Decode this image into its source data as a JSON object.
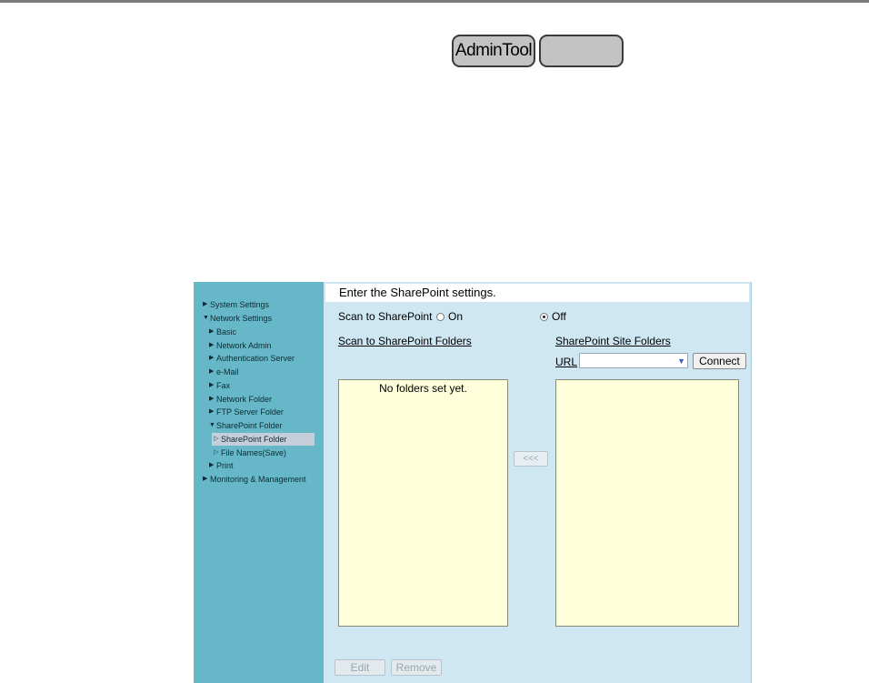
{
  "top_buttons": {
    "admin_tool": "AdminTool",
    "blank": ""
  },
  "sidebar": {
    "items": [
      {
        "label": "System Settings",
        "arrow": "▶"
      },
      {
        "label": "Network Settings",
        "arrow": "▼"
      },
      {
        "label": "Basic",
        "arrow": "▶"
      },
      {
        "label": "Network Admin",
        "arrow": "▶"
      },
      {
        "label": "Authentication Server",
        "arrow": "▶"
      },
      {
        "label": "e-Mail",
        "arrow": "▶"
      },
      {
        "label": "Fax",
        "arrow": "▶"
      },
      {
        "label": "Network Folder",
        "arrow": "▶"
      },
      {
        "label": "FTP Server Folder",
        "arrow": "▶"
      },
      {
        "label": "SharePoint Folder",
        "arrow": "▼"
      },
      {
        "label": "SharePoint Folder",
        "arrow": "▷"
      },
      {
        "label": "File Names(Save)",
        "arrow": "▷"
      },
      {
        "label": "Print",
        "arrow": "▶"
      },
      {
        "label": "Monitoring & Management",
        "arrow": "▶"
      }
    ]
  },
  "main": {
    "header": "Enter the SharePoint settings.",
    "scan_label": "Scan to SharePoint",
    "option_on": "On",
    "option_off": "Off",
    "selected_option": "Off",
    "left_section_title": "Scan to SharePoint Folders",
    "right_section_title": "SharePoint Site Folders",
    "url_label": "URL",
    "url_value": "",
    "connect_button": "Connect",
    "empty_message": "No folders set yet.",
    "move_button": "<<<",
    "edit_button": "Edit",
    "remove_button": "Remove"
  },
  "colors": {
    "sidebar_bg": "#66b8c9",
    "main_bg": "#cfe7f2",
    "folder_box_bg": "#ffffdc",
    "selected_item_bg": "#c5ced9"
  }
}
